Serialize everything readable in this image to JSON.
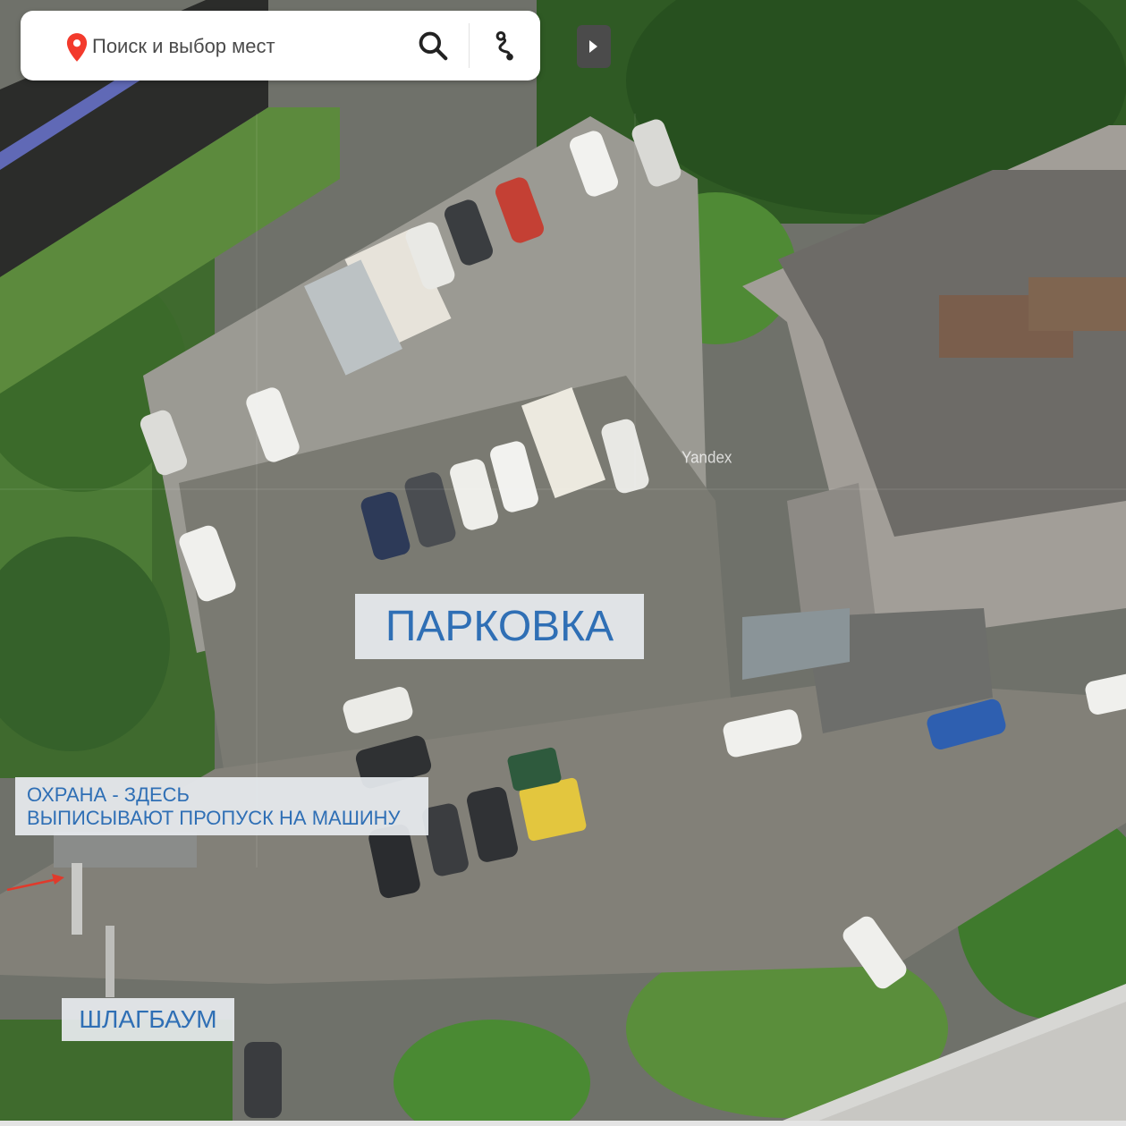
{
  "search": {
    "placeholder": "Поиск и выбор мест",
    "icon_pin": "location-pin-icon",
    "icon_search": "search-icon",
    "icon_route": "route-icon",
    "pin_color": "#f33a2c"
  },
  "panel_toggle": {
    "icon": "play-right-icon"
  },
  "map": {
    "watermark": "Yandex",
    "labels": {
      "parking": "ПАРКОВКА",
      "security_line1": "ОХРАНА - ЗДЕСЬ",
      "security_line2": "ВЫПИСЫВАЮТ ПРОПУСК НА МАШИНУ",
      "barrier": "ШЛАГБАУМ"
    },
    "label_color": "#2f6fb5",
    "arrow_color": "#e03a2c"
  }
}
